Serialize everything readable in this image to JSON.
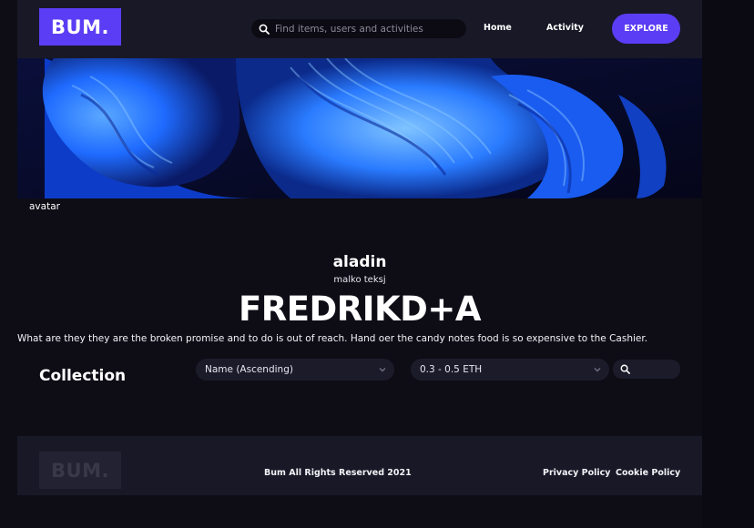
{
  "header": {
    "logo_text": "BUM.",
    "search_placeholder": "Find items, users and activities",
    "nav": {
      "home": "Home",
      "activity": "Activity"
    },
    "explore_label": "EXPLORE"
  },
  "banner": {
    "avatar_alt_text": "avatar"
  },
  "profile": {
    "username": "aladin",
    "subtitle": "malko teksj",
    "display_name": "FREDRIKD+A",
    "bio": "What are they they are the broken promise and to do is out of reach. Hand oer the candy notes food is so expensive to the Cashier."
  },
  "collection": {
    "title": "Collection",
    "sort_value": "Name (Ascending)",
    "price_value": "0.3 - 0.5 ETH"
  },
  "footer": {
    "logo_text": "BUM.",
    "copyright": "Bum All Rights Reserved 2021",
    "privacy_label": "Privacy Policy",
    "cookie_label": "Cookie Policy"
  },
  "colors": {
    "accent": "#5b3df5",
    "background": "#0e0d16",
    "surface": "#191827",
    "banner_blue": "#1f6bff"
  }
}
